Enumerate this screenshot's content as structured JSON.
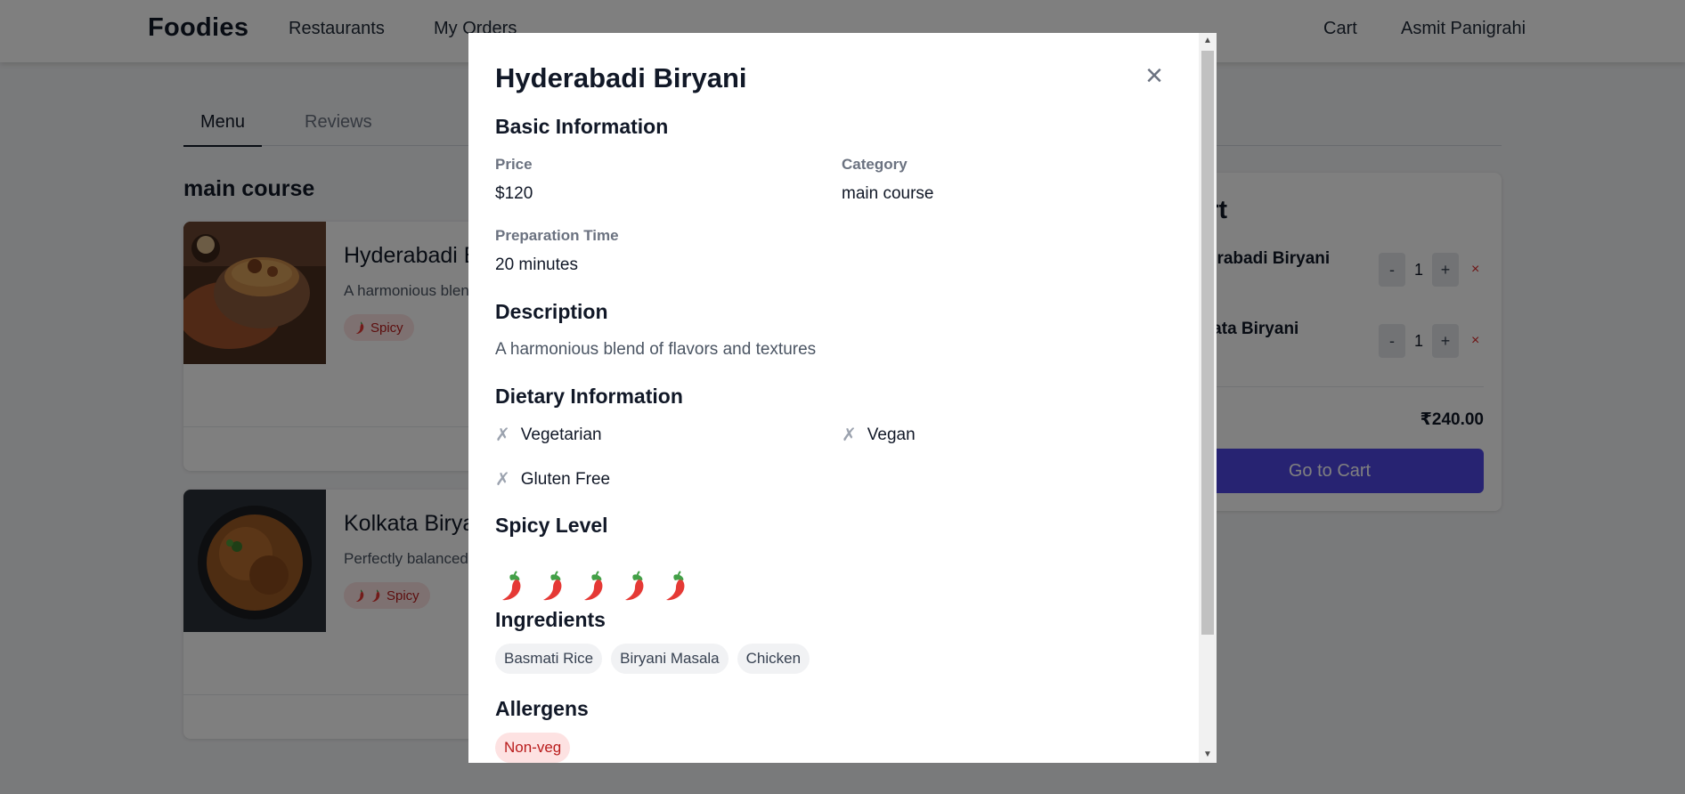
{
  "nav": {
    "brand": "Foodies",
    "restaurants": "Restaurants",
    "orders": "My Orders",
    "cart": "Cart",
    "user": "Asmit Panigrahi"
  },
  "tabs": {
    "menu": "Menu",
    "reviews": "Reviews"
  },
  "section_title": "main course",
  "menu_items": [
    {
      "name": "Hyderabadi Biryani",
      "description": "A harmonious blend of flavors and textures",
      "spicy_label": "Spicy",
      "chilis": 1
    },
    {
      "name": "Kolkata Biryani",
      "description": "Perfectly balanced",
      "spicy_label": "Spicy",
      "chilis": 2
    }
  ],
  "cart": {
    "title": "Cart",
    "items": [
      {
        "name": "Hyderabadi Biryani",
        "qty": "1",
        "minus": "-",
        "plus": "+",
        "remove": "×"
      },
      {
        "name": "Kolkata Biryani",
        "qty": "1",
        "minus": "-",
        "plus": "+",
        "remove": "×"
      }
    ],
    "total": "₹240.00",
    "checkout": "Go to Cart"
  },
  "modal": {
    "title": "Hyderabadi Biryani",
    "close": "×",
    "basic_heading": "Basic Information",
    "price_label": "Price",
    "price_value": "$120",
    "category_label": "Category",
    "category_value": "main course",
    "prep_label": "Preparation Time",
    "prep_value": "20 minutes",
    "description_heading": "Description",
    "description": "A harmonious blend of flavors and textures",
    "dietary_heading": "Dietary Information",
    "dietary": [
      {
        "label": "Vegetarian",
        "mark": "✗"
      },
      {
        "label": "Vegan",
        "mark": "✗"
      },
      {
        "label": "Gluten Free",
        "mark": "✗"
      }
    ],
    "spicy_heading": "Spicy Level",
    "spicy_level": 5,
    "ingredients_heading": "Ingredients",
    "ingredients": [
      "Basmati Rice",
      "Biryani Masala",
      "Chicken"
    ],
    "allergens_heading": "Allergens",
    "allergens": [
      "Non-veg"
    ]
  },
  "colors": {
    "accent": "#4f46e5",
    "danger": "#dc2626",
    "spicy_badge_bg": "#fde2e2",
    "chili_red": "#e53935",
    "chili_green": "#43a047"
  },
  "icons": {
    "close": "close-icon",
    "chili": "chili-pepper-icon",
    "cross": "cross-icon"
  }
}
